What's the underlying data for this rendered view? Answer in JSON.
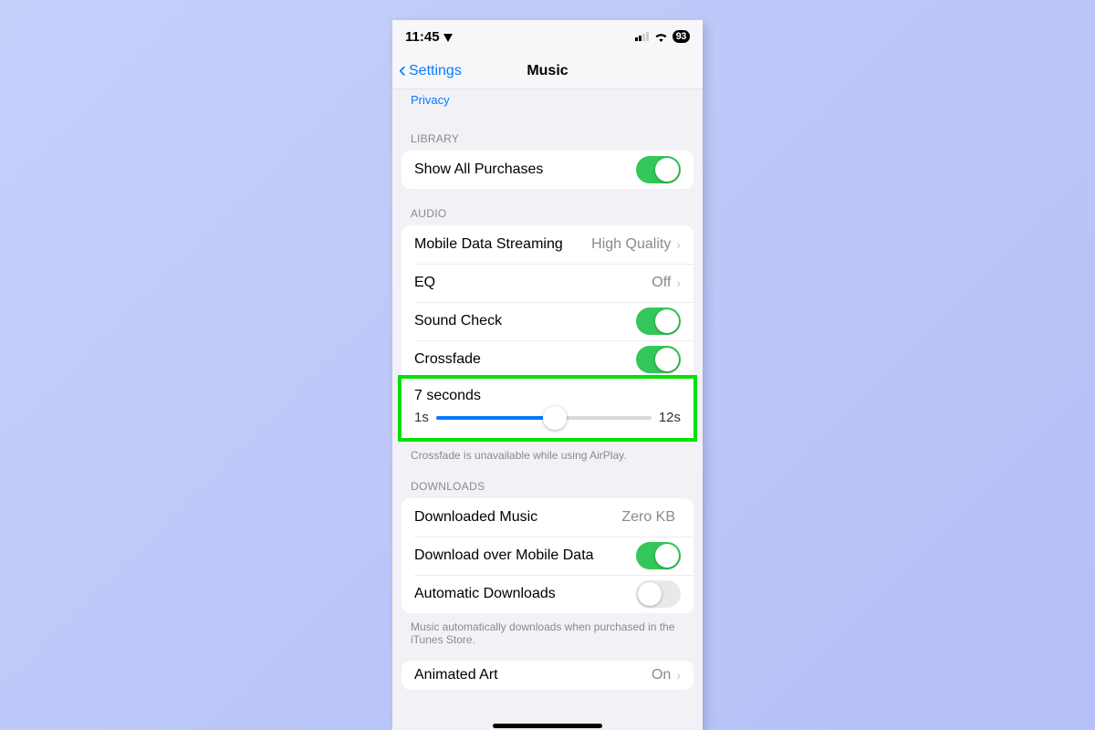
{
  "statusBar": {
    "time": "11:45",
    "battery": "93"
  },
  "nav": {
    "back": "Settings",
    "title": "Music"
  },
  "topLink": "Privacy",
  "sections": {
    "library": {
      "header": "LIBRARY",
      "showAllPurchases": "Show All Purchases"
    },
    "audio": {
      "header": "AUDIO",
      "mobileStreaming": {
        "label": "Mobile Data Streaming",
        "value": "High Quality"
      },
      "eq": {
        "label": "EQ",
        "value": "Off"
      },
      "soundCheck": "Sound Check",
      "crossfade": "Crossfade",
      "crossfadeSlider": {
        "current": "7 seconds",
        "min": "1s",
        "max": "12s",
        "percent": 55
      },
      "footnote": "Crossfade is unavailable while using AirPlay."
    },
    "downloads": {
      "header": "DOWNLOADS",
      "downloadedMusic": {
        "label": "Downloaded Music",
        "value": "Zero KB"
      },
      "downloadCellular": "Download over Mobile Data",
      "autoDownloads": "Automatic Downloads",
      "footnote": "Music automatically downloads when purchased in the iTunes Store."
    },
    "animatedArt": {
      "label": "Animated Art",
      "value": "On"
    }
  }
}
